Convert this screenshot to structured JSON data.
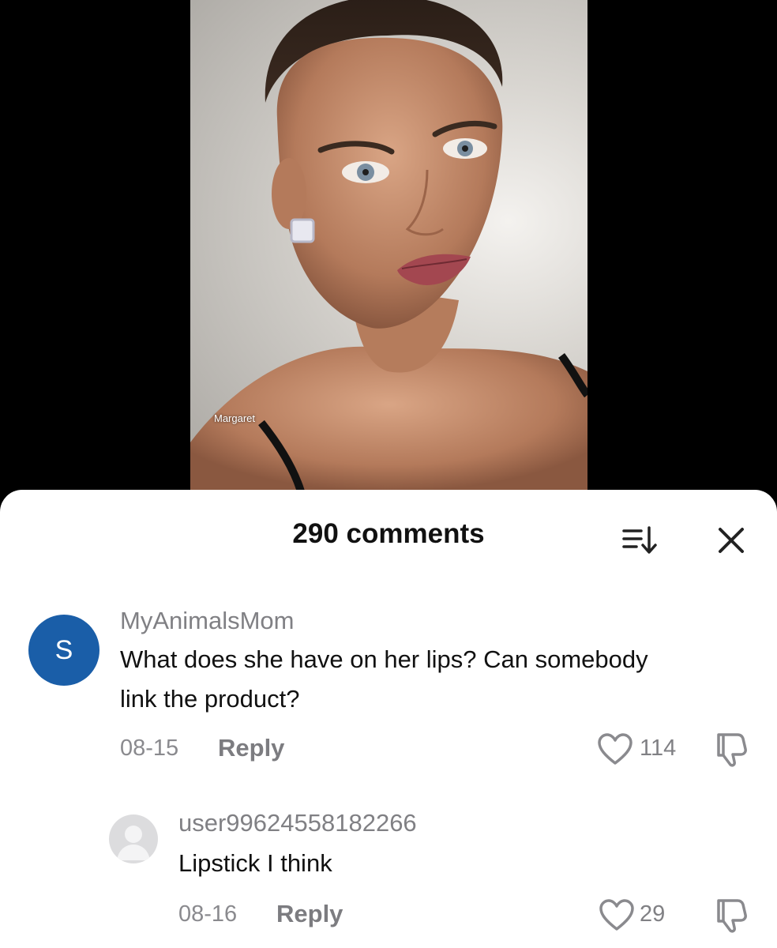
{
  "video": {
    "caption": "Margaret"
  },
  "comments_sheet": {
    "title": "290 comments",
    "sort_icon": "sort-icon",
    "close_icon": "close-icon"
  },
  "comments": [
    {
      "avatar_letter": "S",
      "username": "MyAnimalsMom",
      "text_line1": "What does she have on her lips? Can somebody",
      "text_line2": "link the product?",
      "date": "08-15",
      "reply_label": "Reply",
      "likes": "114"
    },
    {
      "avatar_letter": "",
      "username": "user99624558182266",
      "text_line1": "Lipstick I think",
      "date": "08-16",
      "reply_label": "Reply",
      "likes": "29"
    }
  ],
  "colors": {
    "avatar_blue": "#1a5ea8",
    "sheet_bg": "#ffffff",
    "muted_text": "#808084"
  }
}
